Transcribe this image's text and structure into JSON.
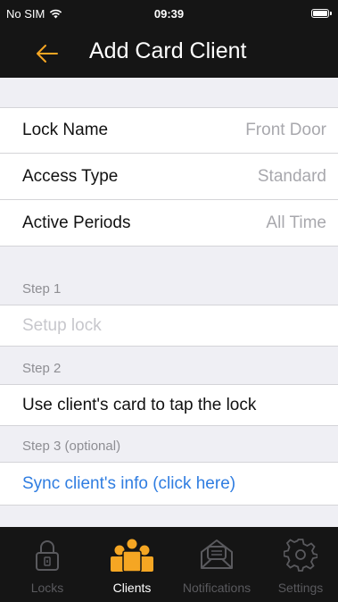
{
  "status": {
    "carrier": "No SIM",
    "time": "09:39"
  },
  "nav": {
    "title": "Add Card Client",
    "accent": "#f5a623"
  },
  "settings": [
    {
      "label": "Lock Name",
      "value": "Front Door"
    },
    {
      "label": "Access Type",
      "value": "Standard"
    },
    {
      "label": "Active Periods",
      "value": "All Time"
    }
  ],
  "steps": {
    "step1_header": "Step 1",
    "step1_action": "Setup lock",
    "step2_header": "Step 2",
    "step2_action": "Use client's card to tap the lock",
    "step3_header": "Step 3 (optional)",
    "step3_action": "Sync client's info (click here)"
  },
  "colors": {
    "disabled": "#c7c7cc",
    "link": "#2f7de1",
    "active_tab": "#f5a623",
    "inactive_tab": "#5a5a5e"
  },
  "tabs": [
    {
      "label": "Locks",
      "icon": "lock-icon",
      "active": false
    },
    {
      "label": "Clients",
      "icon": "clients-icon",
      "active": true
    },
    {
      "label": "Notifications",
      "icon": "notifications-icon",
      "active": false
    },
    {
      "label": "Settings",
      "icon": "settings-gear-icon",
      "active": false
    }
  ]
}
